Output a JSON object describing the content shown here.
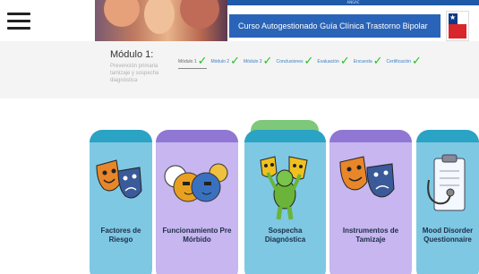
{
  "header": {
    "banner_small_text": "ANGAC",
    "course_title": "Curso Autogestionado Guía Clínica Trastorno Bipolar"
  },
  "module": {
    "title": "Módulo 1:",
    "subtitle": "Prevención primaria tamizaje y sospecha diagnóstica",
    "steps": [
      {
        "label": "Módulo 1",
        "done": true
      },
      {
        "label": "Módulo 2",
        "done": true
      },
      {
        "label": "Módulo 3",
        "done": true
      },
      {
        "label": "Conclusiones",
        "done": true
      },
      {
        "label": "Evaluación",
        "done": true
      },
      {
        "label": "Encuesta",
        "done": true
      },
      {
        "label": "Certificación",
        "done": true
      }
    ],
    "check_glyph": "✓"
  },
  "cards": [
    {
      "label": "Factores de Riesgo",
      "icon": "theater-masks-icon"
    },
    {
      "label": "Funcionamiento Pre Mórbido",
      "icon": "puzzle-heads-icon"
    },
    {
      "label": "Sospecha Diagnóstica",
      "icon": "mask-character-icon"
    },
    {
      "label": "Instrumentos de Tamizaje",
      "icon": "theater-masks-icon"
    },
    {
      "label": "Mood Disorder Questionnaire",
      "icon": "clipboard-stethoscope-icon"
    }
  ],
  "colors": {
    "course_bar": "#2a64b8",
    "card_teal": "#7ec8e3",
    "card_purple": "#c7b6ef",
    "check_green": "#22c31f"
  }
}
